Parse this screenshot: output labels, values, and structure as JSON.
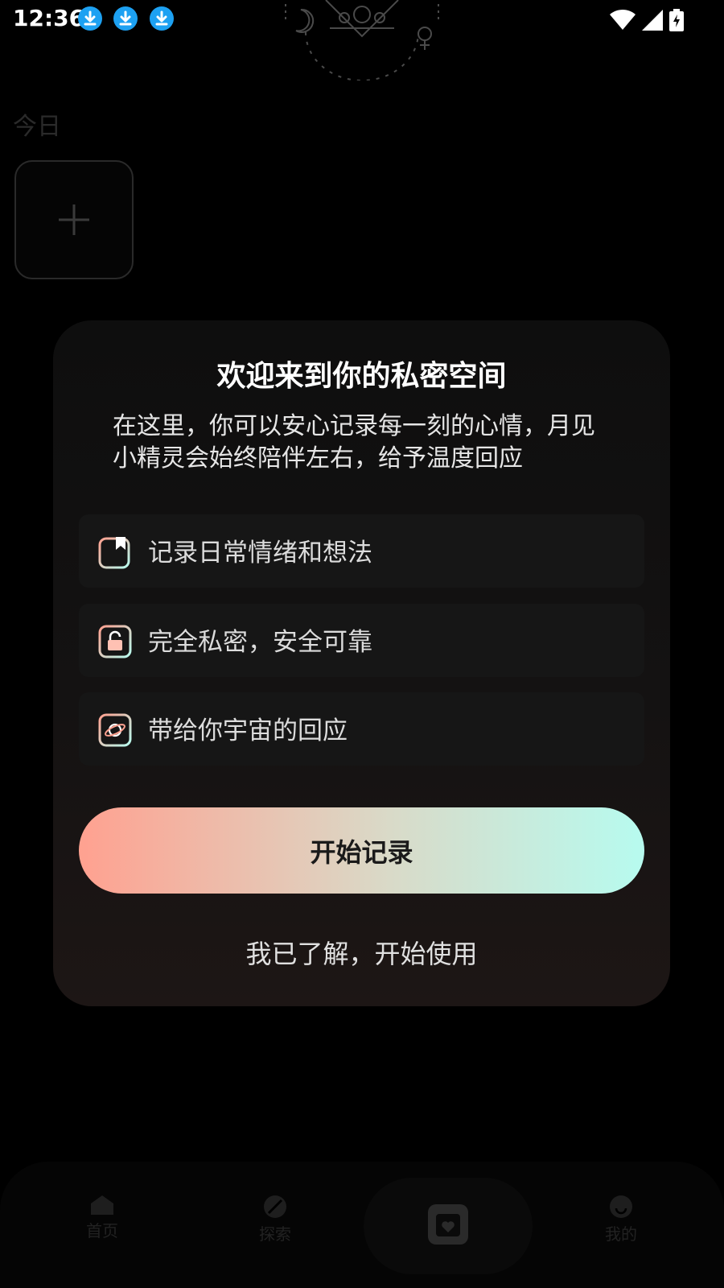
{
  "status_bar": {
    "time": "12:36"
  },
  "background": {
    "today_label": "今日",
    "nav": [
      {
        "label": "首页"
      },
      {
        "label": "探索"
      },
      {
        "label": "我的"
      }
    ]
  },
  "dialog": {
    "title": "欢迎来到你的私密空间",
    "description": "在这里，你可以安心记录每一刻的心情，月见小精灵会始终陪伴左右，给予温度回应",
    "features": [
      {
        "label": "记录日常情绪和想法",
        "icon": "bookmark-note-icon"
      },
      {
        "label": "完全私密，安全可靠",
        "icon": "lock-icon"
      },
      {
        "label": "带给你宇宙的回应",
        "icon": "planet-icon"
      }
    ],
    "primary_button": "开始记录",
    "secondary_link": "我已了解，开始使用"
  },
  "colors": {
    "gradient_start": "#ffa190",
    "gradient_end": "#b7fbef",
    "dialog_bg": "#121010"
  }
}
